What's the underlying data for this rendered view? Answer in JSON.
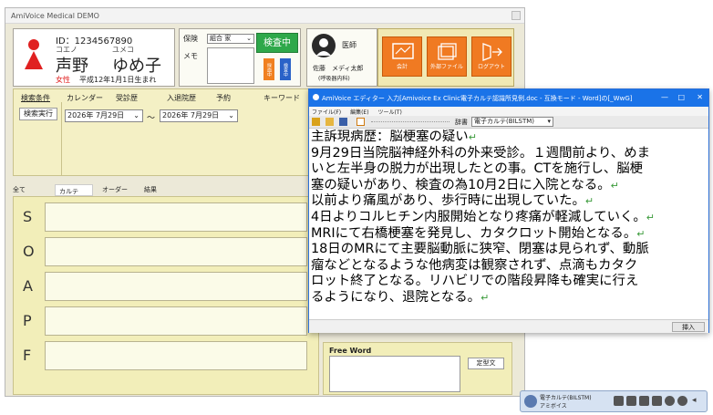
{
  "main_window": {
    "title": "AmiVoice Medical DEMO",
    "patient": {
      "id": "ID：1234567890",
      "kana_family": "コエノ",
      "kana_given": "ユメコ",
      "name_family": "声野",
      "name_given": "ゆめ子",
      "sex": "女性",
      "birth": "平成12年1月1日生まれ"
    },
    "insurance": {
      "label": "保険",
      "value": "組合 家",
      "memo_label": "メモ",
      "kensa_button": "検査中",
      "vbtn1": "採血中",
      "vbtn2": "検査中"
    },
    "doctor": {
      "role": "医師",
      "name": "佐藤　メディ太郎",
      "dept": "(呼吸器内科)"
    },
    "actions": [
      {
        "label": "会計"
      },
      {
        "label": "外部ファイル"
      },
      {
        "label": "ログアウト"
      }
    ],
    "search": {
      "tabs": [
        "検索条件",
        "カレンダー",
        "受診歴",
        "入退院歴",
        "予約",
        "キーワード"
      ],
      "execute_button": "検索実行",
      "date_from": "2026年 7月29日",
      "date_to": "2026年 7月29日",
      "range_sep": "～"
    },
    "record_tabs": [
      "全て",
      "カルテ",
      "オーダー",
      "結果"
    ],
    "soap_labels": [
      "S",
      "O",
      "A",
      "P",
      "F"
    ],
    "free_word": {
      "label": "Free Word",
      "button": "定型文"
    }
  },
  "editor": {
    "title": "AmiVoice エディター  入力[Amivoice Ex Clinic電子カルテ認識所見例.doc - 互換モード - Word]の[_WwG]",
    "menu": [
      "ファイル(F)",
      "編集(E)",
      "ツール(T)"
    ],
    "dict_label": "辞書",
    "dict_value": "電子カルテ(BILSTM)",
    "lines": [
      "主訴現病歴：脳梗塞の疑い",
      "9月29日当院脳神経外科の外来受診。１週間前より、めま",
      "いと左半身の脱力が出現したとの事。CTを施行し、脳梗",
      "塞の疑いがあり、検査の為10月2日に入院となる。",
      "以前より痛風があり、歩行時に出現していた。",
      "4日よりコルヒチン内服開始となり疼痛が軽減していく。",
      "MRIにて右橋梗塞を発見し、カタクロット開始となる。",
      "18日のMRにて主要脳動脈に狭窄、閉塞は見られず、動脈",
      "瘤などとなるような他病変は観察されず、点滴もカタク",
      "ロット終了となる。リハビリでの階段昇降も確実に行え",
      "るようになり、退院となる。"
    ],
    "return_mark": "↵",
    "insert_button": "挿入",
    "win_controls": [
      "—",
      "□",
      "✕"
    ]
  },
  "widget": {
    "line1": "電子カルテ(BILSTM)",
    "line2": "アミボイス"
  },
  "colors": {
    "editor_titlebar": "#1a73e8",
    "action_orange": "#f07a22",
    "kensa_green": "#2ea84a",
    "patient_red": "#e02020"
  }
}
